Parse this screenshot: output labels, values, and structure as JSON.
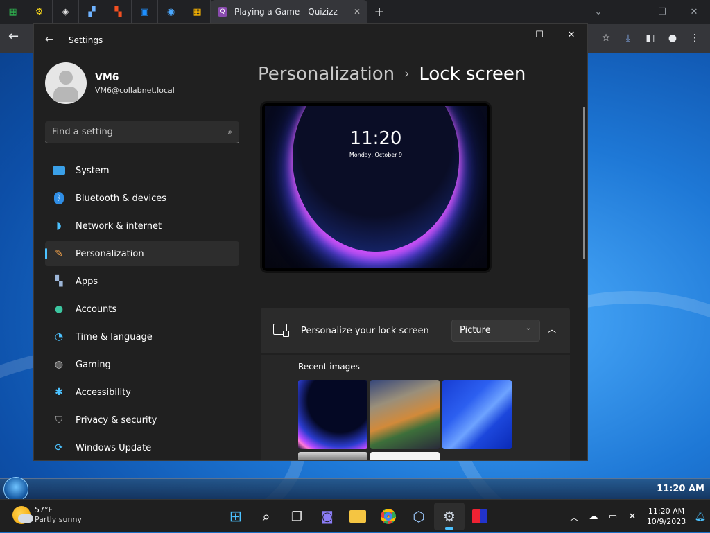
{
  "browser": {
    "active_tab_title": "Playing a Game - Quizizz",
    "new_tab_label": "+"
  },
  "settings": {
    "app_title": "Settings",
    "user": {
      "name": "VM6",
      "email": "VM6@collabnet.local"
    },
    "search_placeholder": "Find a setting",
    "nav_items": [
      {
        "label": "System",
        "icon": "system-icon"
      },
      {
        "label": "Bluetooth & devices",
        "icon": "bluetooth-icon"
      },
      {
        "label": "Network & internet",
        "icon": "wifi-icon"
      },
      {
        "label": "Personalization",
        "icon": "brush-icon",
        "selected": true
      },
      {
        "label": "Apps",
        "icon": "apps-icon"
      },
      {
        "label": "Accounts",
        "icon": "person-icon"
      },
      {
        "label": "Time & language",
        "icon": "clock-icon"
      },
      {
        "label": "Gaming",
        "icon": "gamepad-icon"
      },
      {
        "label": "Accessibility",
        "icon": "accessibility-icon"
      },
      {
        "label": "Privacy & security",
        "icon": "shield-icon"
      },
      {
        "label": "Windows Update",
        "icon": "update-icon"
      }
    ],
    "breadcrumb": {
      "parent": "Personalization",
      "separator": "›",
      "current": "Lock screen"
    },
    "preview": {
      "time": "11:20",
      "date": "Monday, October 9"
    },
    "personalize": {
      "label": "Personalize your lock screen",
      "value": "Picture"
    },
    "recent_images_label": "Recent images"
  },
  "taskbar7": {
    "time": "11:20 AM"
  },
  "taskbar": {
    "weather": {
      "temp": "57°F",
      "desc": "Partly sunny"
    },
    "clock": {
      "time": "11:20 AM",
      "date": "10/9/2023"
    }
  }
}
